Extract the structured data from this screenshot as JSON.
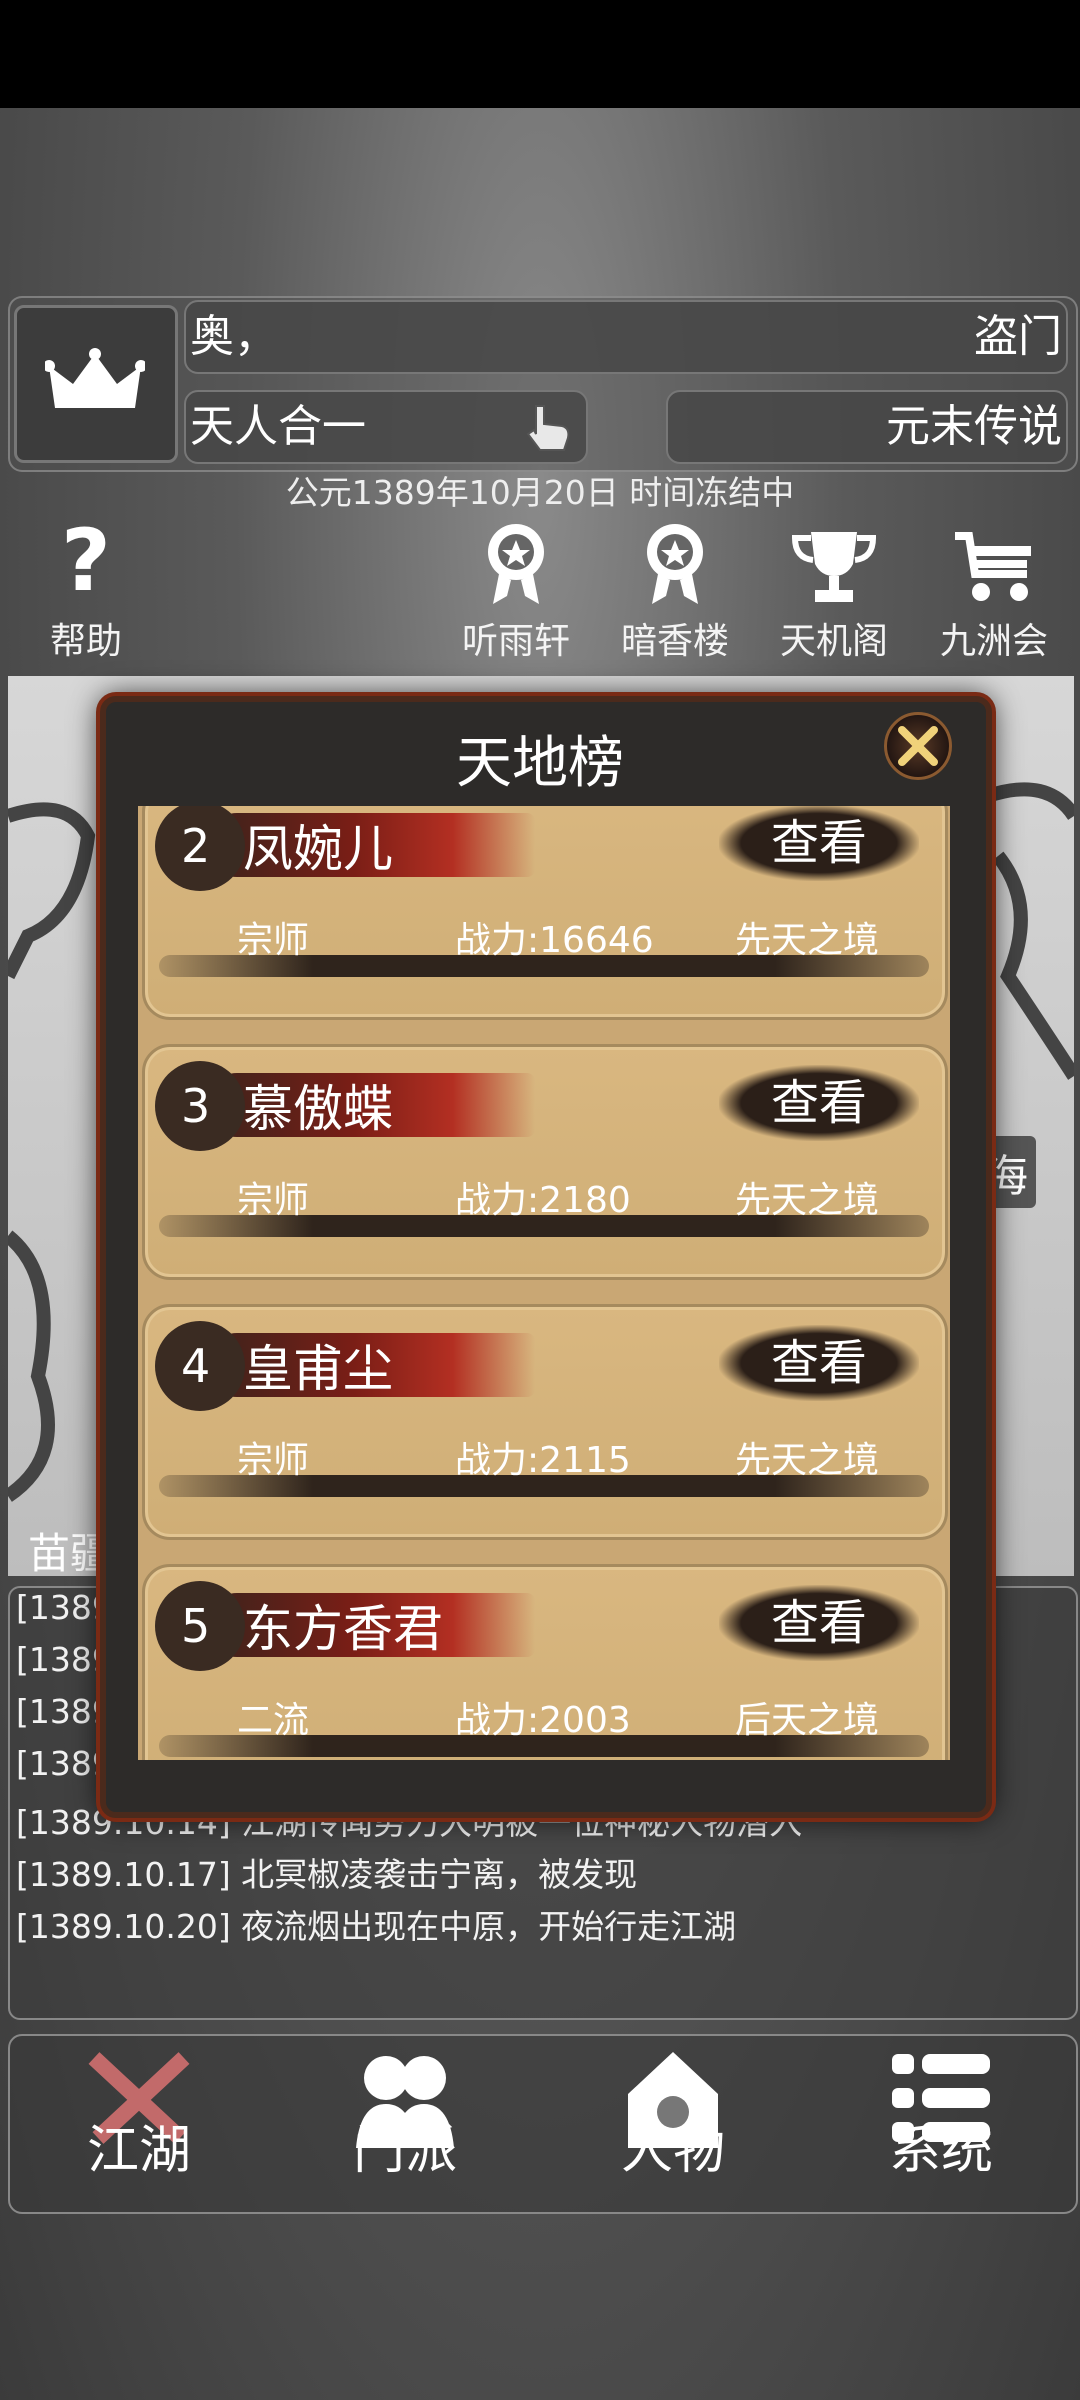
{
  "header": {
    "player_name": "奥，",
    "sect": "盗门",
    "skill": "天人合一",
    "era": "元末传说",
    "date_line": "公元1389年10月20日 时间冻结中"
  },
  "icon_row": [
    {
      "label": "帮助",
      "icon": "question-icon"
    },
    {
      "label": "听雨轩",
      "icon": "badge-icon"
    },
    {
      "label": "暗香楼",
      "icon": "badge-icon"
    },
    {
      "label": "天机阁",
      "icon": "trophy-icon"
    },
    {
      "label": "九洲会",
      "icon": "cart-icon"
    }
  ],
  "map": {
    "label_sea": "海",
    "label_region": "苗疆"
  },
  "log": {
    "lines": [
      "[1389.",
      "[1389.",
      "[1389.",
      "[1389.",
      "[1389.10.14] 江湖传闻势力大明被一位神秘人物潜入",
      "[1389.10.17] 北冥椒凌袭击宁离，被发现",
      "[1389.10.20] 夜流烟出现在中原，开始行走江湖"
    ]
  },
  "modal": {
    "title": "天地榜",
    "entries": [
      {
        "rank": "2",
        "name": "凤婉儿",
        "title": "宗师",
        "power": "战力:16646",
        "realm": "先天之境",
        "action": "查看"
      },
      {
        "rank": "3",
        "name": "慕傲蝶",
        "title": "宗师",
        "power": "战力:2180",
        "realm": "先天之境",
        "action": "查看"
      },
      {
        "rank": "4",
        "name": "皇甫尘",
        "title": "宗师",
        "power": "战力:2115",
        "realm": "先天之境",
        "action": "查看"
      },
      {
        "rank": "5",
        "name": "东方香君",
        "title": "二流",
        "power": "战力:2003",
        "realm": "后天之境",
        "action": "查看"
      }
    ]
  },
  "nav": [
    {
      "label": "江湖",
      "icon": "crossed-swords-icon"
    },
    {
      "label": "门派",
      "icon": "people-icon"
    },
    {
      "label": "人物",
      "icon": "person-icon"
    },
    {
      "label": "系统",
      "icon": "list-icon"
    }
  ]
}
